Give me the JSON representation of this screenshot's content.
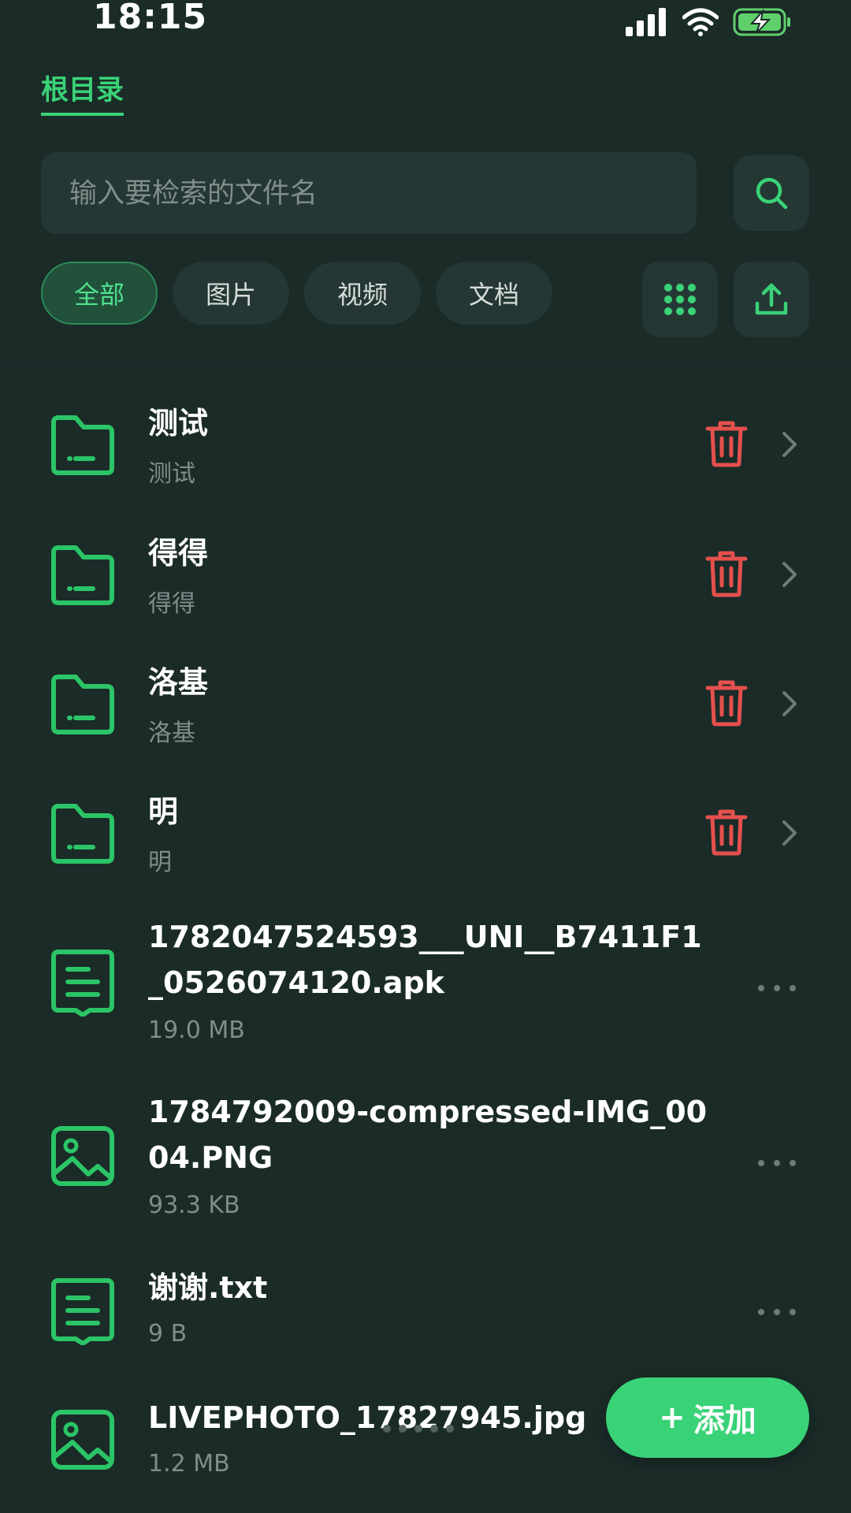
{
  "status_bar": {
    "time": "18:15",
    "icons": [
      "signal-icon",
      "wifi-icon",
      "battery-charging-icon"
    ]
  },
  "breadcrumb": {
    "current": "根目录"
  },
  "search": {
    "placeholder": "输入要检索的文件名",
    "value": ""
  },
  "filters": [
    {
      "label": "全部",
      "active": true
    },
    {
      "label": "图片",
      "active": false
    },
    {
      "label": "视频",
      "active": false
    },
    {
      "label": "文档",
      "active": false
    }
  ],
  "toolbar": {
    "view_toggle_icon": "grid-icon",
    "upload_icon": "upload-icon",
    "search_icon": "search-icon"
  },
  "folders": [
    {
      "name": "测试",
      "subtitle": "测试"
    },
    {
      "name": "得得",
      "subtitle": "得得"
    },
    {
      "name": "洛基",
      "subtitle": "洛基"
    },
    {
      "name": "明",
      "subtitle": "明"
    }
  ],
  "files": [
    {
      "name": "1782047524593___UNI__B7411F1_0526074120.apk",
      "size": "19.0 MB",
      "kind": "document"
    },
    {
      "name": "1784792009-compressed-IMG_0004.PNG",
      "size": "93.3 KB",
      "kind": "image"
    },
    {
      "name": "谢谢.txt",
      "size": "9 B",
      "kind": "document"
    },
    {
      "name": "LIVEPHOTO_17827945.jpg",
      "size": "1.2 MB",
      "kind": "image"
    }
  ],
  "fab": {
    "icon": "+",
    "label": "添加"
  },
  "colors": {
    "background": "#1a2b28",
    "accent": "#3ad277",
    "danger": "#e5504d",
    "muted": "#7f8e8a"
  }
}
